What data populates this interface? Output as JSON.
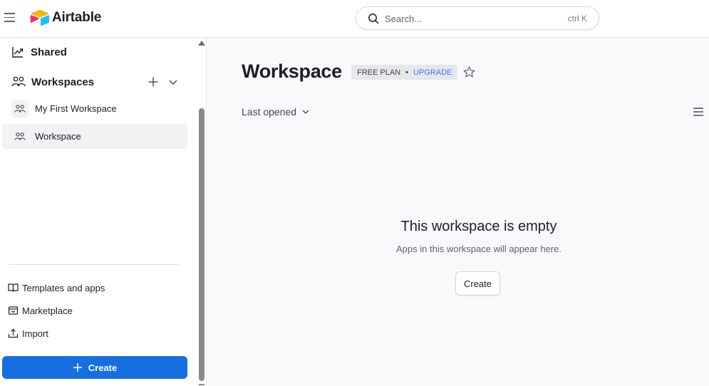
{
  "app": {
    "name": "Airtable"
  },
  "search": {
    "placeholder": "Search...",
    "shortcut": "ctrl K"
  },
  "sidebar": {
    "shared_label": "Shared",
    "workspaces_label": "Workspaces",
    "workspaces": [
      {
        "label": "My First Workspace",
        "active": false
      },
      {
        "label": "Workspace",
        "active": true
      }
    ],
    "links": [
      {
        "label": "Templates and apps",
        "icon": "book-open-icon"
      },
      {
        "label": "Marketplace",
        "icon": "marketplace-icon"
      },
      {
        "label": "Import",
        "icon": "upload-icon"
      }
    ],
    "create_label": "Create"
  },
  "main": {
    "title": "Workspace",
    "plan": "FREE PLAN",
    "plan_separator": "•",
    "upgrade_label": "UPGRADE",
    "sort_label": "Last opened",
    "empty_title": "This workspace is empty",
    "empty_subtitle": "Apps in this workspace will appear here.",
    "create_label": "Create"
  },
  "colors": {
    "primary": "#166ee1",
    "upgrade_link": "#2d7ff9",
    "main_bg": "#f8f9fb",
    "logo_yellow": "#fcb400",
    "logo_red": "#f82b60",
    "logo_blue": "#18bfff"
  }
}
